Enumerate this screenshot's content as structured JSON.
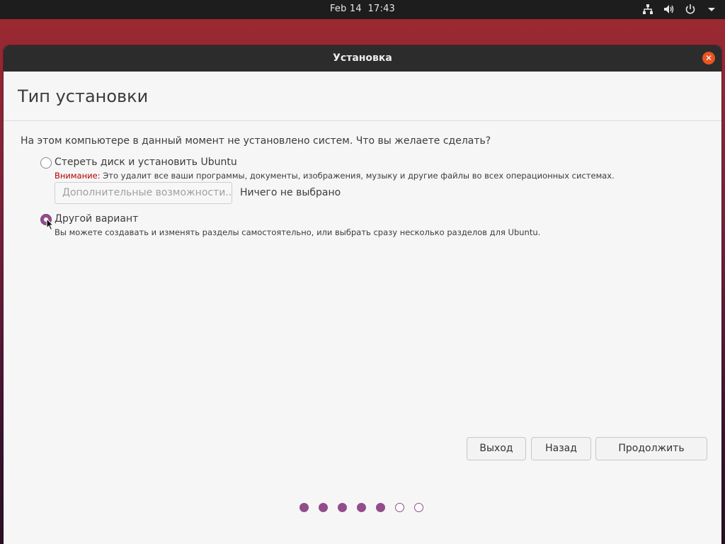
{
  "topbar": {
    "date": "Feb 14",
    "time": "17:43",
    "icons": [
      "network-icon",
      "volume-icon",
      "power-icon",
      "menu-arrow-icon"
    ]
  },
  "window": {
    "title": "Установка",
    "close_icon": "close-icon",
    "accent_color": "#e95420"
  },
  "page": {
    "title": "Тип установки",
    "question": "На этом компьютере в данный момент не установлено систем. Что вы желаете сделать?"
  },
  "options": [
    {
      "label": "Стереть диск и установить Ubuntu",
      "note_warn": "Внимание:",
      "note": " Это удалит все ваши программы, документы, изображения, музыку и другие файлы во всех операционных системах.",
      "checked": false,
      "advanced_button": "Дополнительные возможности...",
      "advanced_status": "Ничего не выбрано"
    },
    {
      "label": "Другой вариант",
      "note": "Вы можете создавать и изменять разделы самостоятельно, или выбрать сразу несколько разделов для Ubuntu.",
      "checked": true
    }
  ],
  "buttons": {
    "quit": "Выход",
    "back": "Назад",
    "continue": "Продолжить"
  },
  "progress": {
    "total_steps": 7,
    "completed_steps": 5,
    "color": "#924d8b"
  }
}
